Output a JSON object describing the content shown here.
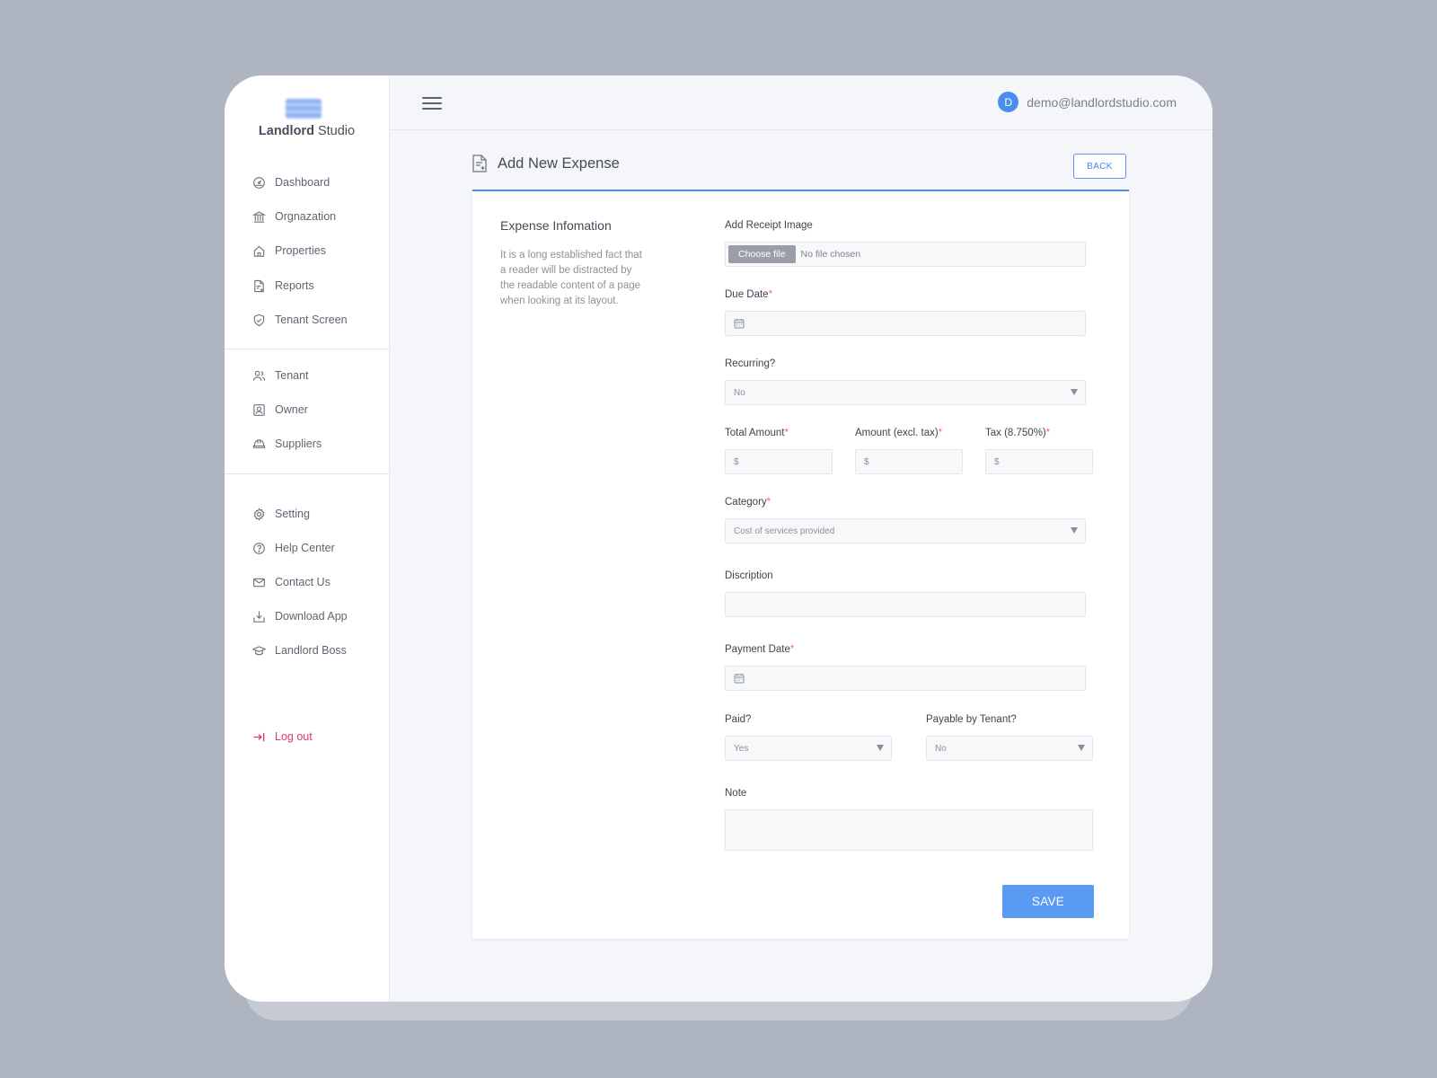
{
  "app": {
    "brand_bold": "Landlord",
    "brand_rest": " Studio"
  },
  "sidebar": {
    "items": [
      {
        "label": "Dashboard",
        "icon": "dashboard-icon"
      },
      {
        "label": "Orgnazation",
        "icon": "bank-icon"
      },
      {
        "label": "Properties",
        "icon": "home-icon"
      },
      {
        "label": "Reports",
        "icon": "report-icon"
      },
      {
        "label": "Tenant Screen",
        "icon": "shield-icon"
      },
      {
        "label": "Tenant",
        "icon": "users-icon"
      },
      {
        "label": "Owner",
        "icon": "owner-icon"
      },
      {
        "label": "Suppliers",
        "icon": "helmet-icon"
      },
      {
        "label": "Setting",
        "icon": "gear-icon"
      },
      {
        "label": "Help Center",
        "icon": "help-icon"
      },
      {
        "label": "Contact Us",
        "icon": "mail-icon"
      },
      {
        "label": "Download App",
        "icon": "download-icon"
      },
      {
        "label": "Landlord Boss",
        "icon": "graduation-cap-icon"
      }
    ],
    "logout": "Log out"
  },
  "header": {
    "avatar_initial": "D",
    "user_email": "demo@landlordstudio.com"
  },
  "page": {
    "title": "Add New Expense",
    "back_label": "BACK"
  },
  "form": {
    "section_title": "Expense Infomation",
    "section_desc": "It is a long established fact that a reader will be distracted by the readable content of a page when looking at its layout.",
    "receipt_label": "Add Receipt Image",
    "file_button": "Choose file",
    "file_status": "No file chosen",
    "due_date_label": "Due Date",
    "recurring_label": "Recurring?",
    "recurring_value": "No",
    "total_amount_label": "Total Amount",
    "amount_excl_label": "Amount (excl. tax)",
    "tax_label": "Tax (8.750%)",
    "currency_symbol": "$",
    "category_label": "Category",
    "category_value": "Cost of services provided",
    "description_label": "Discription",
    "payment_date_label": "Payment Date",
    "paid_label": "Paid?",
    "paid_value": "Yes",
    "payable_label": "Payable by Tenant?",
    "payable_value": "No",
    "note_label": "Note",
    "required_mark": "*",
    "save_label": "SAVE"
  },
  "colors": {
    "accent": "#4a8ff0",
    "required": "#f3705a",
    "logout": "#e5336b"
  }
}
